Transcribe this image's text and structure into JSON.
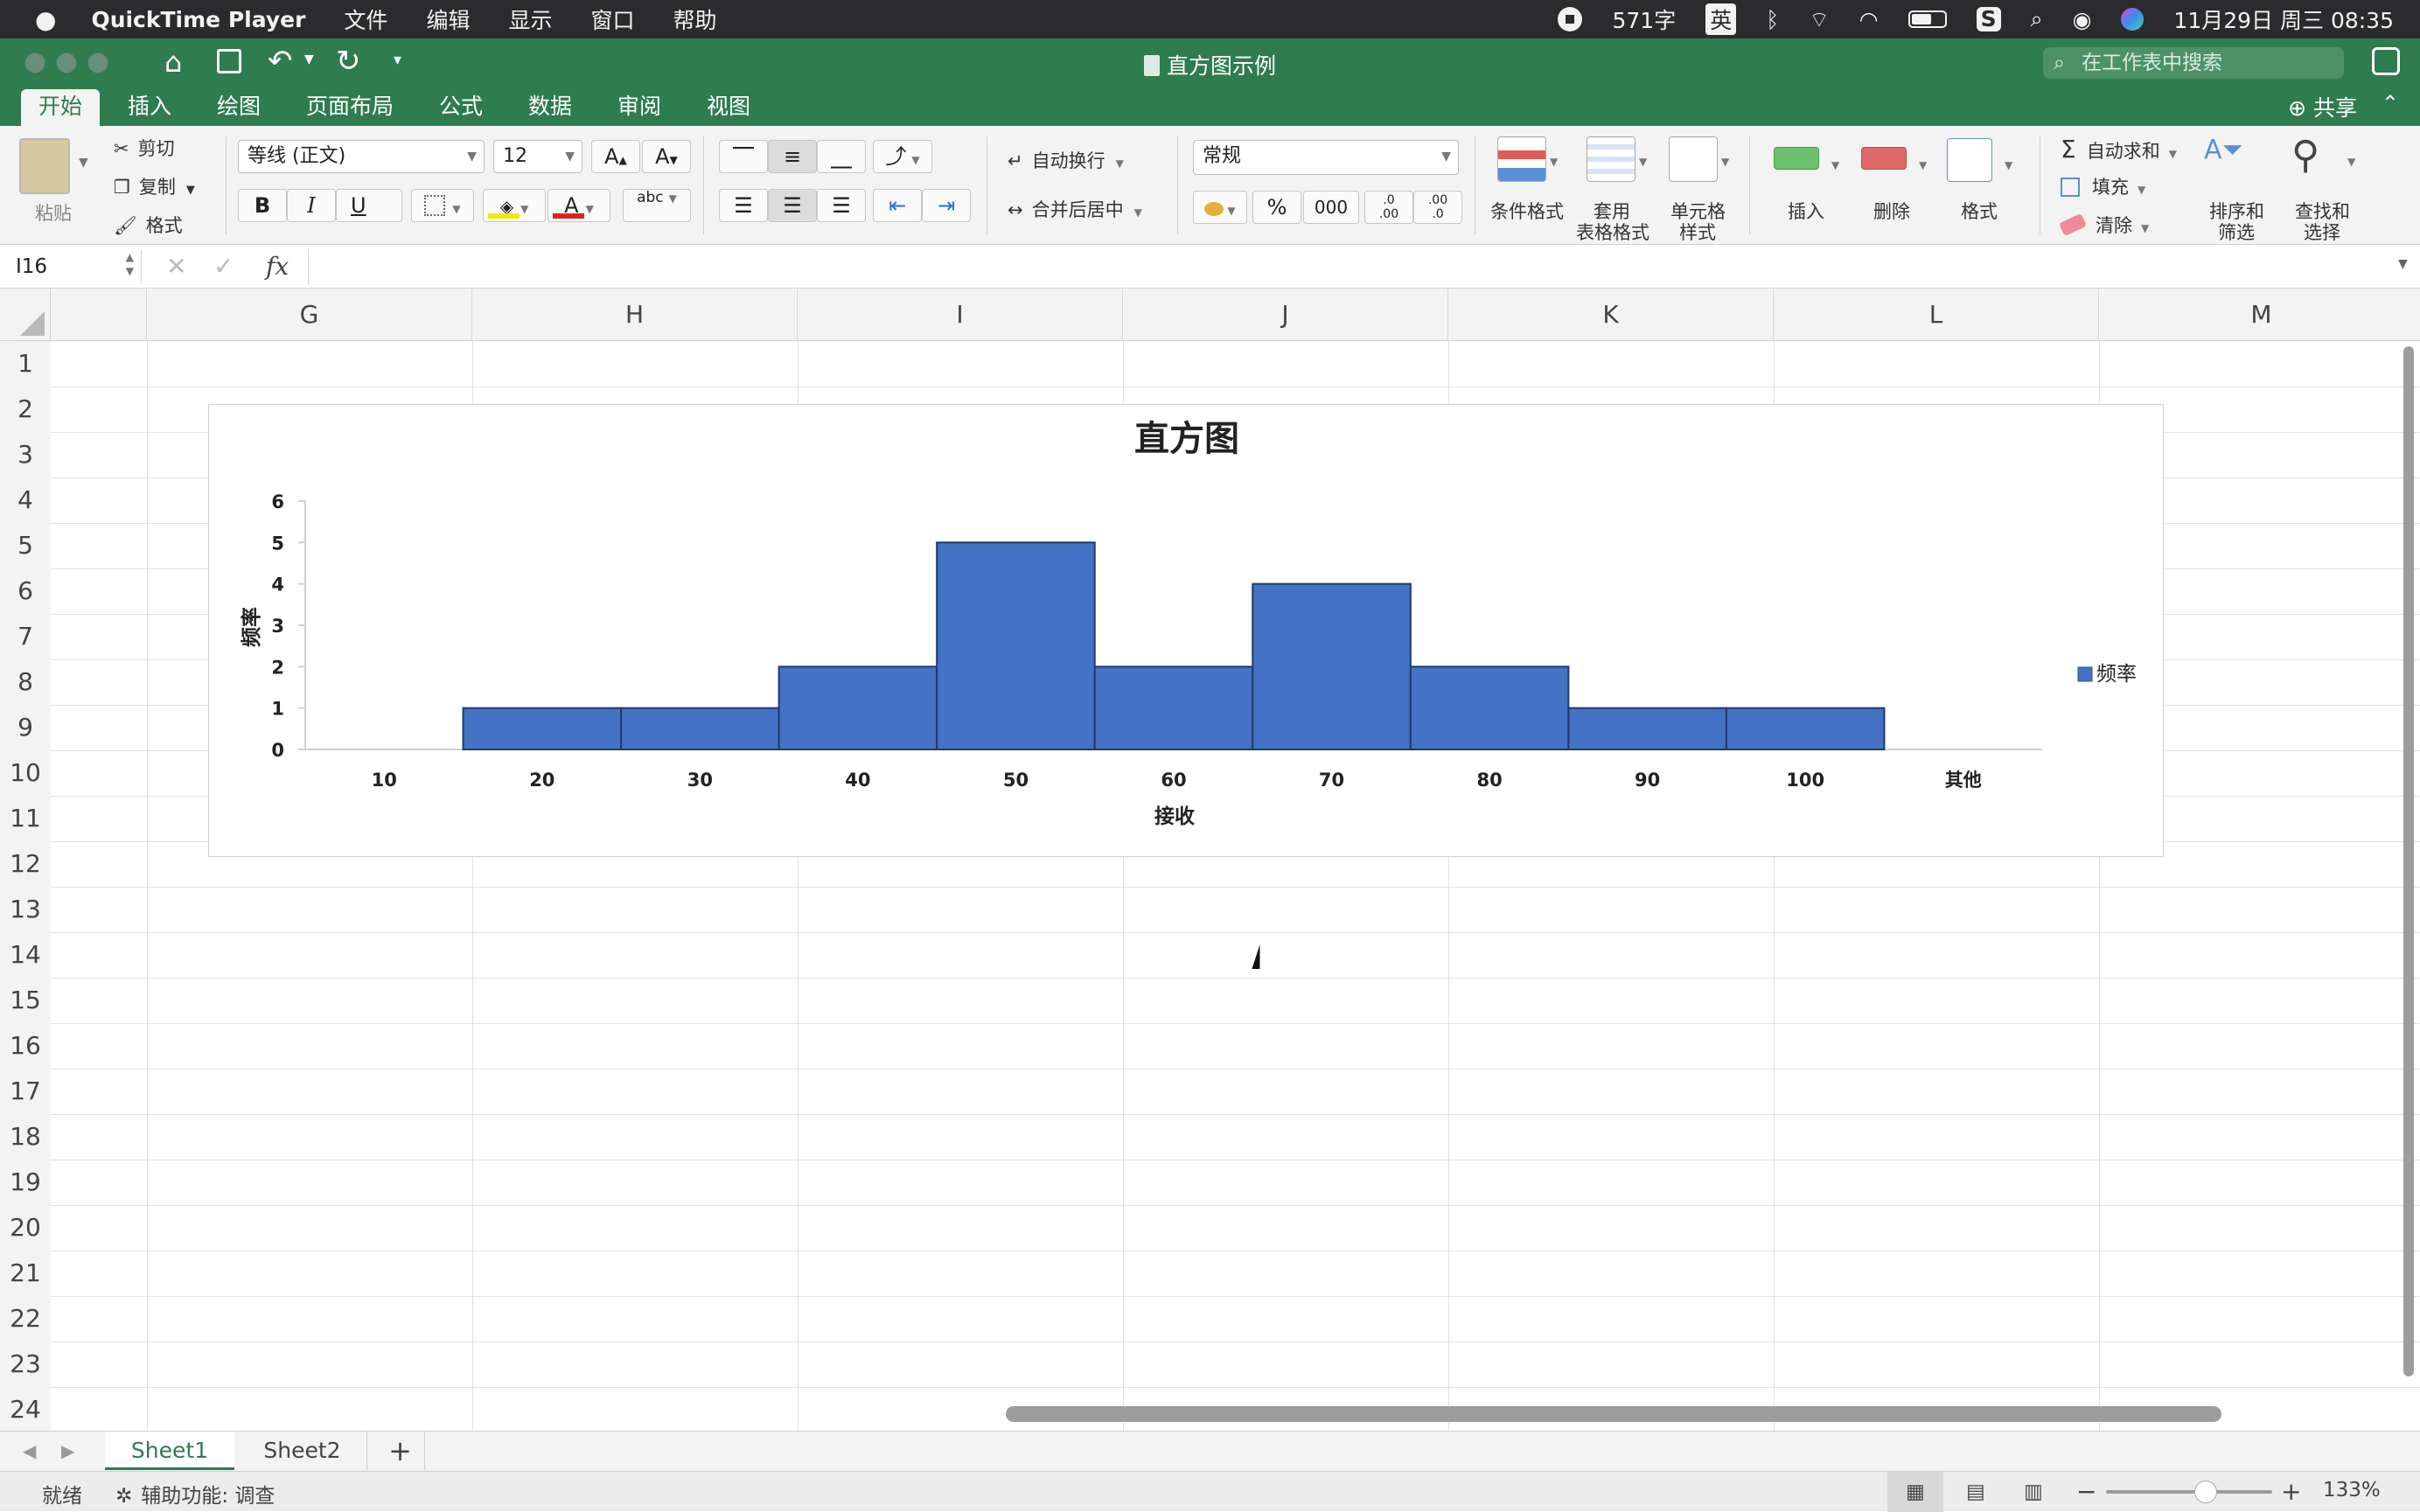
{
  "menubar": {
    "app": "QuickTime Player",
    "items": [
      "文件",
      "编辑",
      "显示",
      "窗口",
      "帮助"
    ],
    "word_count": "571字",
    "input_method": "英",
    "datetime": "11月29日 周三  08:35"
  },
  "window": {
    "title": "直方图示例",
    "search_placeholder": "在工作表中搜索",
    "share": "共享"
  },
  "ribbon": {
    "tabs": [
      "开始",
      "插入",
      "绘图",
      "页面布局",
      "公式",
      "数据",
      "审阅",
      "视图"
    ],
    "active_tab": "开始",
    "clipboard": {
      "paste": "粘贴",
      "cut": "剪切",
      "copy": "复制",
      "format": "格式"
    },
    "font": {
      "name": "等线 (正文)",
      "size": "12",
      "bold": "B",
      "italic": "I",
      "underline": "U",
      "grow": "A",
      "shrink": "A",
      "color_letter": "A",
      "phonetic": "abc"
    },
    "alignment": {
      "wrap": "自动换行",
      "merge": "合并后居中"
    },
    "number": {
      "format": "常规",
      "percent": "%",
      "thousands": "000",
      "inc_decimal": ".0\n.00",
      "dec_decimal": ".00\n.0"
    },
    "styles": {
      "conditional": "条件格式",
      "table_line1": "套用",
      "table_line2": "表格格式",
      "cell_line1": "单元格",
      "cell_line2": "样式"
    },
    "cells": {
      "insert": "插入",
      "delete": "删除",
      "format": "格式"
    },
    "editing": {
      "autosum": "自动求和",
      "fill": "填充",
      "clear": "清除",
      "sort_line1": "排序和",
      "sort_line2": "筛选",
      "find_line1": "查找和",
      "find_line2": "选择"
    },
    "colors": {
      "fill": "#f5e600",
      "font": "#e0241b"
    }
  },
  "formula_bar": {
    "name_box": "I16",
    "fx": "fx",
    "content": ""
  },
  "grid": {
    "columns": [
      "G",
      "H",
      "I",
      "J",
      "K",
      "L",
      "M"
    ],
    "rows": [
      "1",
      "2",
      "3",
      "4",
      "5",
      "6",
      "7",
      "8",
      "9",
      "10",
      "11",
      "12",
      "13",
      "14",
      "15",
      "16",
      "17",
      "18",
      "19",
      "20",
      "21",
      "22",
      "23",
      "24"
    ]
  },
  "chart_data": {
    "type": "bar",
    "title": "直方图",
    "xlabel": "接收",
    "ylabel": "频率",
    "categories": [
      "10",
      "20",
      "30",
      "40",
      "50",
      "60",
      "70",
      "80",
      "90",
      "100",
      "其他"
    ],
    "series": [
      {
        "name": "频率",
        "values": [
          0,
          1,
          1,
          2,
          5,
          2,
          4,
          2,
          1,
          1,
          0
        ],
        "color": "#4472c4"
      }
    ],
    "yticks": [
      "0",
      "1",
      "2",
      "3",
      "4",
      "5",
      "6"
    ],
    "ylim": [
      0,
      6
    ],
    "grid": false,
    "legend": "right"
  },
  "sheets": {
    "tabs": [
      "Sheet1",
      "Sheet2"
    ],
    "active": "Sheet1",
    "add": "+"
  },
  "status": {
    "ready": "就绪",
    "accessibility": "辅助功能: 调查",
    "zoom": "133%",
    "zoom_level": 0.6,
    "minus": "−",
    "plus": "+"
  }
}
